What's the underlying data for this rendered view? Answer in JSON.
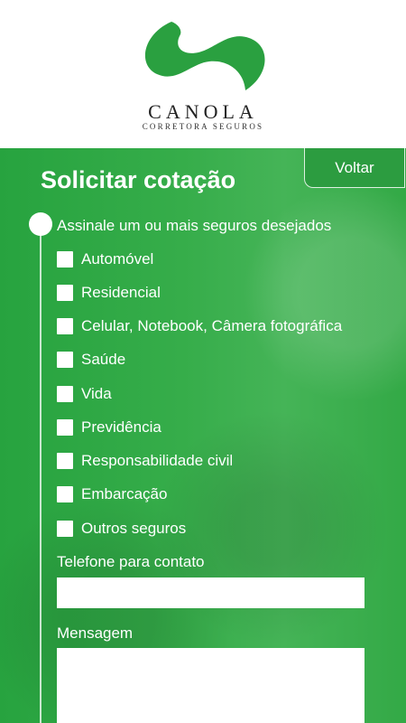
{
  "brand": {
    "name": "CANOLA",
    "subtitle": "CORRETORA SEGUROS",
    "color": "#2aa040"
  },
  "page": {
    "title": "Solicitar cotação",
    "back_label": "Voltar"
  },
  "form": {
    "section_label": "Assinale um ou mais seguros desejados",
    "options": [
      {
        "label": "Automóvel",
        "checked": false
      },
      {
        "label": "Residencial",
        "checked": false
      },
      {
        "label": "Celular, Notebook, Câmera fotográfica",
        "checked": false
      },
      {
        "label": "Saúde",
        "checked": false
      },
      {
        "label": "Vida",
        "checked": false
      },
      {
        "label": "Previdência",
        "checked": false
      },
      {
        "label": "Responsabilidade civil",
        "checked": false
      },
      {
        "label": "Embarcação",
        "checked": false
      },
      {
        "label": "Outros seguros",
        "checked": false
      }
    ],
    "phone_label": "Telefone para contato",
    "phone_value": "",
    "message_label": "Mensagem",
    "message_value": ""
  }
}
